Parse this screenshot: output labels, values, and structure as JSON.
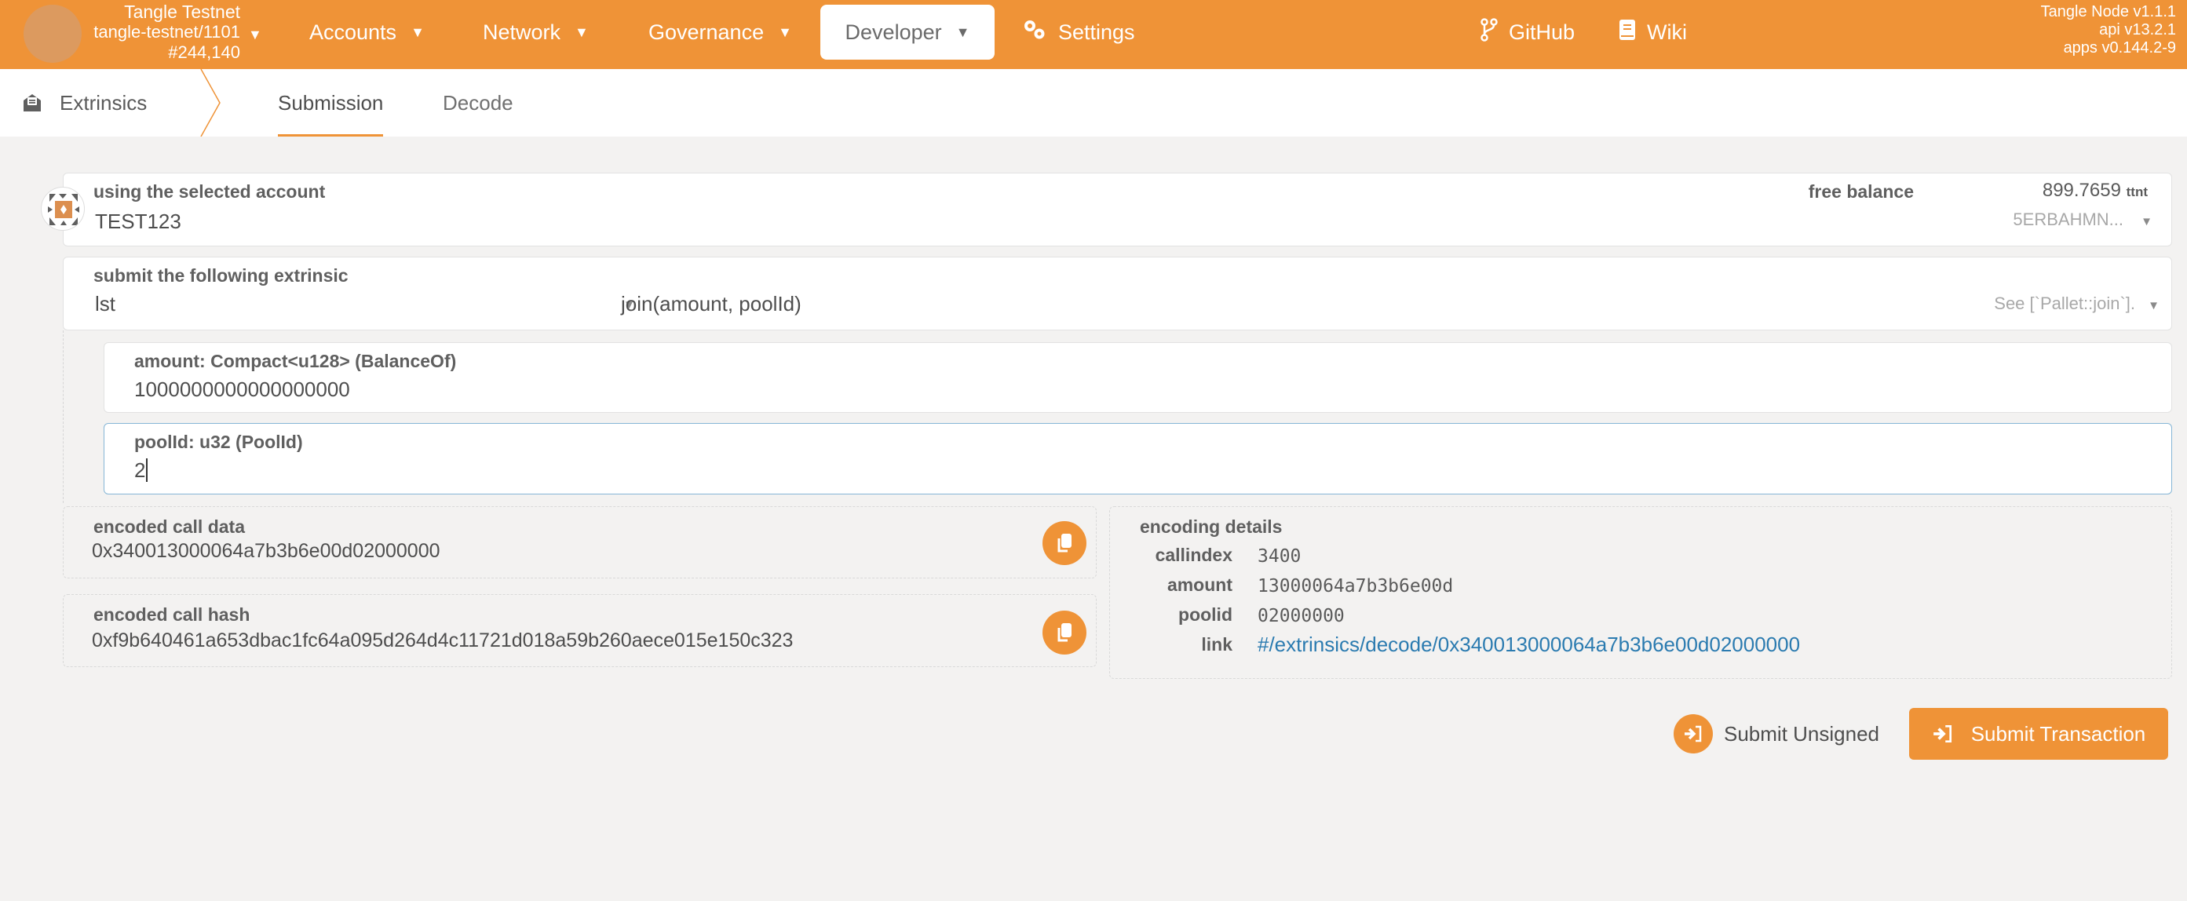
{
  "header": {
    "chain": {
      "name": "Tangle Testnet",
      "runtime": "tangle-testnet/1101",
      "block": "#244,140"
    },
    "nav": [
      {
        "label": "Accounts",
        "has_dropdown": true,
        "active": false
      },
      {
        "label": "Network",
        "has_dropdown": true,
        "active": false
      },
      {
        "label": "Governance",
        "has_dropdown": true,
        "active": false
      },
      {
        "label": "Developer",
        "has_dropdown": true,
        "active": true
      },
      {
        "label": "Settings",
        "icon": "gears-icon",
        "active": false
      }
    ],
    "links": [
      {
        "label": "GitHub",
        "icon": "code-branch-icon"
      },
      {
        "label": "Wiki",
        "icon": "book-icon"
      }
    ],
    "versions": {
      "node": "Tangle Node v1.1.1",
      "api": "api v13.2.1",
      "apps": "apps v0.144.2-9"
    },
    "accent_color": "#ef9337"
  },
  "tabs": {
    "section": "Extrinsics",
    "section_icon": "envelope-open-text-icon",
    "items": [
      {
        "label": "Submission",
        "active": true
      },
      {
        "label": "Decode",
        "active": false
      }
    ]
  },
  "account": {
    "label": "using the selected account",
    "name": "TEST123",
    "free_balance_label": "free balance",
    "free_balance_value": "899.7659",
    "free_balance_unit": "ttnt",
    "address": "5ERBAHMN..."
  },
  "extrinsic": {
    "label": "submit the following extrinsic",
    "pallet": "lst",
    "call": "join(amount, poolId)",
    "call_doc": "See [`Pallet::join`]."
  },
  "params": [
    {
      "label": "amount: Compact<u128> (BalanceOf)",
      "value": "1000000000000000000",
      "focused": false
    },
    {
      "label": "poolId: u32 (PoolId)",
      "value": "2",
      "focused": true
    }
  ],
  "encoded_call_data": {
    "label": "encoded call data",
    "value": "0x340013000064a7b3b6e00d02000000"
  },
  "encoded_call_hash": {
    "label": "encoded call hash",
    "value": "0xf9b640461a653dbac1fc64a095d264d4c11721d018a59b260aece015e150c323"
  },
  "encoding_details": {
    "title": "encoding details",
    "rows": [
      {
        "key": "callindex",
        "value": "3400"
      },
      {
        "key": "amount",
        "value": "13000064a7b3b6e00d"
      },
      {
        "key": "poolid",
        "value": "02000000"
      },
      {
        "key": "link",
        "value": "#/extrinsics/decode/0x340013000064a7b3b6e00d02000000"
      }
    ]
  },
  "actions": {
    "submit_unsigned": "Submit Unsigned",
    "submit_transaction": "Submit Transaction"
  }
}
